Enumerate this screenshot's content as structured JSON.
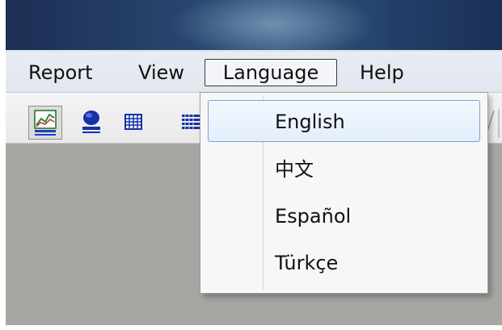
{
  "menubar": {
    "items": [
      {
        "label": "Report"
      },
      {
        "label": "View"
      },
      {
        "label": "Language",
        "active": true
      },
      {
        "label": "Help"
      }
    ]
  },
  "toolbar": {
    "buttons": [
      {
        "icon": "chart-icon",
        "pressed": true
      },
      {
        "icon": "globe-icon",
        "pressed": false
      },
      {
        "icon": "table-icon",
        "pressed": false
      },
      {
        "icon": "list-icon",
        "pressed": false
      }
    ]
  },
  "language_menu": {
    "highlighted": "English",
    "options": [
      {
        "label": "English"
      },
      {
        "label": "中文"
      },
      {
        "label": "Español"
      },
      {
        "label": "Türkçe"
      }
    ]
  },
  "colors": {
    "titlebar": "#223e68",
    "menubar": "#e5e8ef",
    "highlight_border": "#7ba2d6",
    "workspace": "#a8a6a3"
  }
}
